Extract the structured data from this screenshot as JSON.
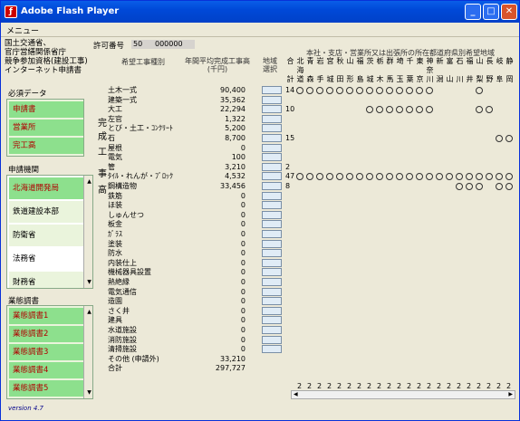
{
  "window": {
    "title": "Adobe Flash Player",
    "menu": "メニュー"
  },
  "header": {
    "lines": [
      "国土交通省、",
      "官庁営繕関係省庁",
      "競争参加資格(建設工事)",
      "インターネット申請書"
    ]
  },
  "permit": {
    "label": "許可番号",
    "v1": "50",
    "v2": "000000"
  },
  "necessary": {
    "title": "必須データ",
    "items": [
      "申請書",
      "営業所",
      "完工高"
    ]
  },
  "agency": {
    "title": "申請機関",
    "items": [
      "北海道開発局",
      "鉄道建設本部",
      "防衛省",
      "法務省",
      "財務省"
    ]
  },
  "business": {
    "title": "業態調書",
    "items": [
      "業態調書1",
      "業態調書2",
      "業態調書3",
      "業態調書4",
      "業態調書5"
    ]
  },
  "version": "version 4.7",
  "table": {
    "col_type": "希望工事種別",
    "col_amount": "年間平均完成工事高\n(千円)",
    "col_region": "地域\n選択",
    "region_title": "本社・支店・営業所又は出張所の所在都道府県別希望地域",
    "side_chars": [
      "完",
      "成",
      "工",
      "事",
      "高"
    ],
    "rows": [
      {
        "name": "土木一式",
        "amount": "90,400",
        "count": "14"
      },
      {
        "name": "建築一式",
        "amount": "35,362",
        "count": ""
      },
      {
        "name": "大工",
        "amount": "22,294",
        "count": "10"
      },
      {
        "name": "左官",
        "amount": "1,322",
        "count": ""
      },
      {
        "name": "とび・土工・ｺﾝｸﾘｰﾄ",
        "amount": "5,200",
        "count": ""
      },
      {
        "name": "石",
        "amount": "8,700",
        "count": "15"
      },
      {
        "name": "屋根",
        "amount": "0",
        "count": ""
      },
      {
        "name": "電気",
        "amount": "100",
        "count": ""
      },
      {
        "name": "管",
        "amount": "3,210",
        "count": "2"
      },
      {
        "name": "ﾀｲﾙ・れんが・ﾌﾞﾛｯｸ",
        "amount": "4,532",
        "count": "47"
      },
      {
        "name": "鋼構造物",
        "amount": "33,456",
        "count": "8"
      },
      {
        "name": "鉄筋",
        "amount": "0",
        "count": ""
      },
      {
        "name": "ほ装",
        "amount": "0",
        "count": ""
      },
      {
        "name": "しゅんせつ",
        "amount": "0",
        "count": ""
      },
      {
        "name": "板金",
        "amount": "0",
        "count": ""
      },
      {
        "name": "ｶﾞﾗｽ",
        "amount": "0",
        "count": ""
      },
      {
        "name": "塗装",
        "amount": "0",
        "count": ""
      },
      {
        "name": "防水",
        "amount": "0",
        "count": ""
      },
      {
        "name": "内装仕上",
        "amount": "0",
        "count": ""
      },
      {
        "name": "機械器具設置",
        "amount": "0",
        "count": ""
      },
      {
        "name": "熱絶縁",
        "amount": "0",
        "count": ""
      },
      {
        "name": "電気通信",
        "amount": "0",
        "count": ""
      },
      {
        "name": "造園",
        "amount": "0",
        "count": ""
      },
      {
        "name": "さく井",
        "amount": "0",
        "count": ""
      },
      {
        "name": "建具",
        "amount": "0",
        "count": ""
      },
      {
        "name": "水道施設",
        "amount": "0",
        "count": ""
      },
      {
        "name": "消防施設",
        "amount": "0",
        "count": ""
      },
      {
        "name": "清掃施設",
        "amount": "0",
        "count": ""
      },
      {
        "name": "その他 (申請外)",
        "amount": "33,210",
        "count": ""
      },
      {
        "name": "合計",
        "amount": "297,727",
        "count": ""
      }
    ],
    "pref_top": [
      "合",
      "北",
      "青",
      "岩",
      "宮",
      "秋",
      "山",
      "福",
      "茨",
      "栃",
      "群",
      "埼",
      "千",
      "東",
      "神",
      "新",
      "富",
      "石",
      "福",
      "山",
      "長",
      "岐",
      "静"
    ],
    "pref_mid": [
      "",
      "海",
      "",
      "",
      "",
      "",
      "",
      "",
      "",
      "",
      "",
      "",
      "",
      "",
      "奈",
      "",
      "",
      "",
      "",
      "",
      "",
      "",
      ""
    ],
    "pref_bot": [
      "計",
      "道",
      "森",
      "手",
      "城",
      "田",
      "形",
      "島",
      "城",
      "木",
      "馬",
      "玉",
      "葉",
      "京",
      "川",
      "潟",
      "山",
      "川",
      "井",
      "梨",
      "野",
      "阜",
      "岡"
    ],
    "circles": [
      {
        "row": 0,
        "cols": [
          1,
          2,
          3,
          4,
          5,
          6,
          7,
          8,
          9,
          10,
          11,
          12,
          13,
          14,
          19
        ]
      },
      {
        "row": 2,
        "cols": [
          8,
          9,
          10,
          11,
          12,
          13,
          14,
          19,
          20
        ]
      },
      {
        "row": 5,
        "cols": [
          21,
          22
        ]
      },
      {
        "row": 9,
        "cols": [
          1,
          2,
          3,
          4,
          5,
          6,
          7,
          8,
          9,
          10,
          11,
          12,
          13,
          14,
          15,
          16,
          17,
          18,
          19,
          20,
          21,
          22
        ]
      },
      {
        "row": 10,
        "cols": [
          17,
          18,
          19,
          21,
          22
        ]
      }
    ],
    "bottom_vals": [
      "2",
      "2",
      "2",
      "2",
      "2",
      "2",
      "2",
      "2",
      "2",
      "2",
      "2",
      "2",
      "2",
      "2",
      "2",
      "2",
      "2",
      "2",
      "2",
      "2",
      "2",
      "2"
    ]
  }
}
